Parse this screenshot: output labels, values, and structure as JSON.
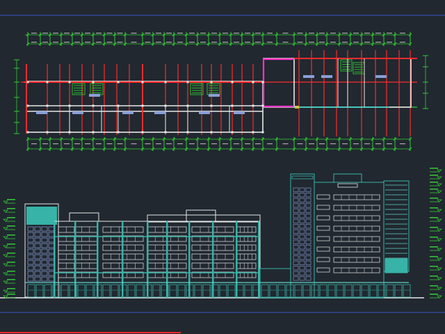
{
  "drawing": {
    "colors": {
      "background": "#212830",
      "border_line": "#3a55c8",
      "dimension": "#33cc33",
      "grid_axis": "#ff2a2a",
      "wall": "#e8e8e8",
      "magenta_wall": "#ff33cc",
      "teal": "#37b3a8",
      "teal_light": "#5fd0c4",
      "window": "#8aa0d8",
      "white_line": "#ffffff",
      "cyan": "#00e0e0",
      "green_fill": "#33dd33"
    },
    "elements": {
      "plan": "floor-plan",
      "elevation": "building-elevation",
      "title_bar": "title-strip"
    }
  }
}
